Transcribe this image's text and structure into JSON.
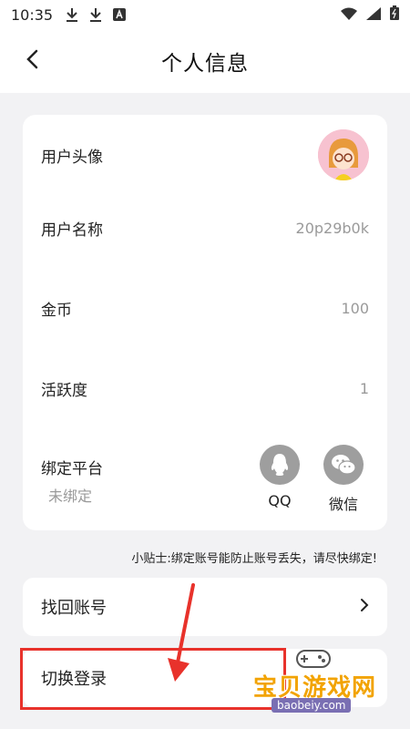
{
  "status_bar": {
    "time": "10:35",
    "icons": [
      "download-icon",
      "download-icon",
      "store-icon"
    ],
    "right_icons": [
      "wifi-icon",
      "signal-icon",
      "battery-icon"
    ]
  },
  "header": {
    "title": "个人信息",
    "back_icon": "chevron-left-icon"
  },
  "profile": {
    "avatar_label": "用户头像",
    "username_label": "用户名称",
    "username_value": "20p29b0k",
    "coins_label": "金币",
    "coins_value": "100",
    "activity_label": "活跃度",
    "activity_value": "1",
    "bind_label": "绑定平台",
    "bind_status": "未绑定",
    "platforms": [
      {
        "label": "QQ",
        "icon": "qq-icon"
      },
      {
        "label": "微信",
        "icon": "wechat-icon"
      }
    ]
  },
  "tip": "小贴士:绑定账号能防止账号丢失，请尽快绑定!",
  "actions": {
    "recover_label": "找回账号",
    "switch_label": "切换登录"
  },
  "watermark": {
    "text": "宝贝游戏网",
    "url": "baobeiy.com"
  },
  "colors": {
    "highlight": "#e8322b",
    "background": "#f2f2f4",
    "watermark": "#f2a300"
  }
}
